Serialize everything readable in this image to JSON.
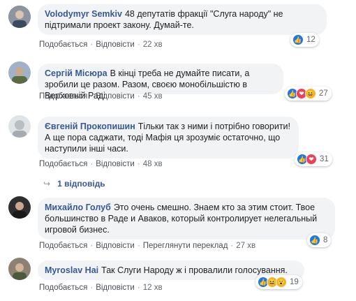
{
  "comments": [
    {
      "author": "Volodymyr Semkiv",
      "text": "48 депутатів фракції \"Слуга народу\" не підтримали проект закону. Думай-те.",
      "like": "Подобається",
      "reply": "Відповісти",
      "time": "22 хв",
      "reaction_count": "12",
      "avatar_color": "#8a8f99"
    },
    {
      "author": "Сергій Місюра",
      "text": "В кінці треба не думайте писати, а зробили це разом. Разом, своєю монобільшістю в Верховній Раді.",
      "like": "Подобається",
      "reply": "Відповісти",
      "time": "45 хв",
      "reaction_count": "27",
      "avatar_color": "#6e7c5a"
    },
    {
      "author": "Євгеній Прокопишин",
      "text": "Тільки так з ними і потрібно говорити! А ще пора саджати, тоді Мафія ця зрозуміє остаточно, що наступили інші часи.",
      "like": "Подобається",
      "reply": "Відповісти",
      "time": "48 хв",
      "reaction_count": "31",
      "avatar_color": "#9aa3a8"
    },
    {
      "author": "Михайло Голуб",
      "text": "Это очень смешно. Знаем кто за этим стоит. Твое большинство в Раде и Аваков, который контролирует нелегальный игровой бизнес.",
      "like": "Подобається",
      "reply": "Відповісти",
      "translate": "Переглянути переклад",
      "time": "27 хв",
      "reaction_count": "8",
      "avatar_color": "#5a5a5a"
    },
    {
      "author": "Myroslav Hai",
      "text": "Так Слуги Народу ж і провалили голосування.",
      "like": "Подобається",
      "reply": "Відповісти",
      "time": "12 хв",
      "reaction_count": "19",
      "avatar_color": "#7a6a55"
    }
  ],
  "replies_link": "1 відповідь",
  "separator": "·"
}
